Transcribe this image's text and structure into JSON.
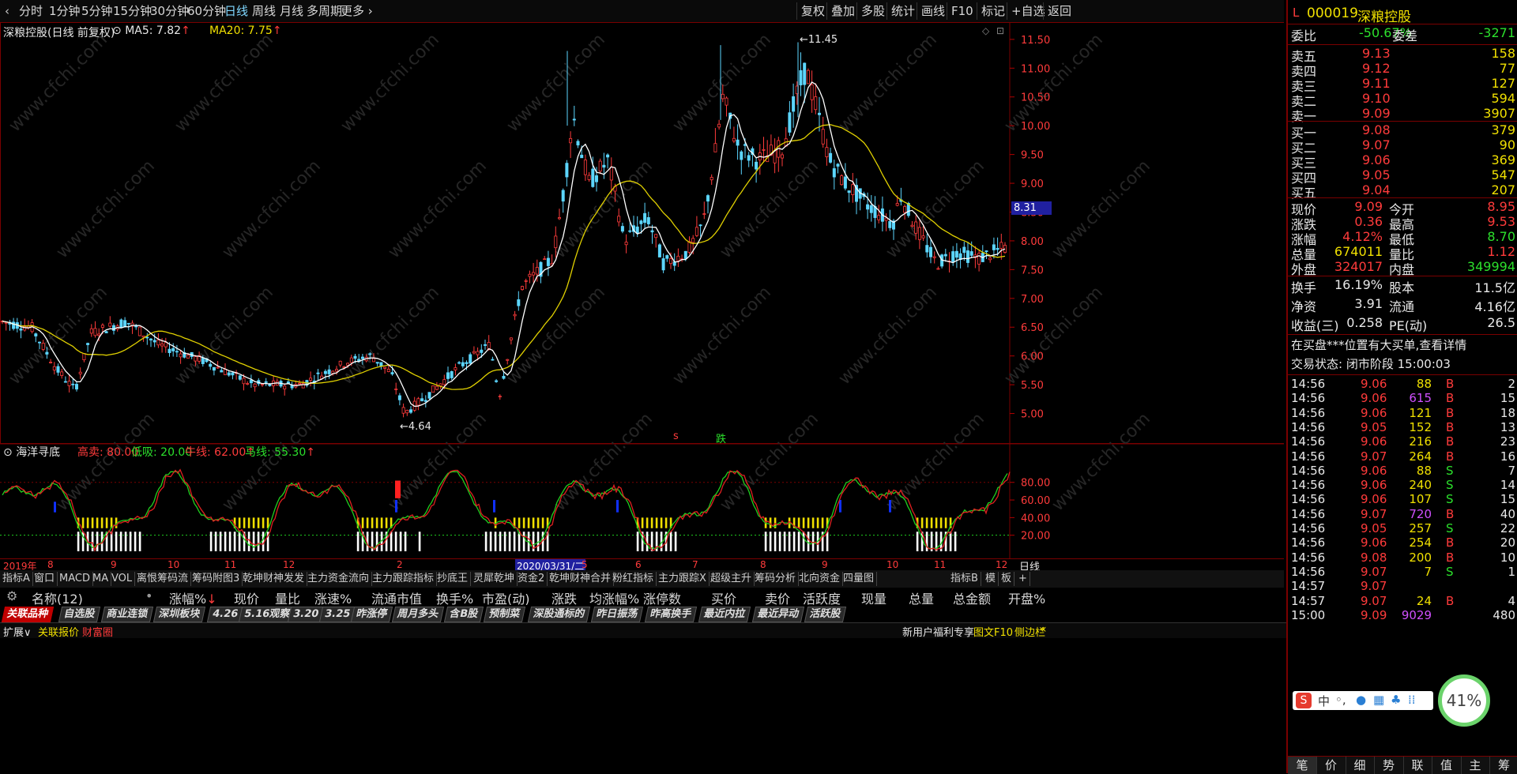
{
  "toolbar": {
    "periods": [
      "分时",
      "1分钟",
      "5分钟",
      "15分钟",
      "30分钟",
      "60分钟",
      "日线",
      "周线",
      "月线",
      "多周期",
      "更多"
    ],
    "active_period": "日线",
    "more_arrow": "›",
    "right_buttons": [
      "复权",
      "叠加",
      "多股",
      "统计",
      "画线",
      "F10",
      "标记",
      "+自选",
      "返回"
    ]
  },
  "chart": {
    "title": "深粮控股(日线 前复权)",
    "ma5_label": "MA5: 7.82",
    "ma20_label": "MA20: 7.75",
    "up_arrow": "↑",
    "watermark": "www.cfchi.com",
    "price_ticks": [
      "11.50",
      "11.00",
      "10.50",
      "10.00",
      "9.50",
      "9.00",
      "8.50",
      "8.00",
      "7.50",
      "7.00",
      "6.50",
      "6.00",
      "5.50",
      "5.00"
    ],
    "current_price_tag": "8.31",
    "high_marker": "11.45",
    "low_marker": "4.64",
    "signal_s": "s",
    "signal_die": "跌",
    "colors": {
      "up": "#ff3b3b",
      "down": "#5cd6ff",
      "ma5": "#ffffff",
      "ma20": "#e0d000"
    }
  },
  "indicator": {
    "name": "海洋寻底",
    "gaomai": "高卖: 80.00",
    "dixi": "低吸: 20.00",
    "niuxian": "牛线: 62.00",
    "maxian": "马线: 55.30",
    "ticks": [
      "80.00",
      "60.00",
      "40.00",
      "20.00"
    ]
  },
  "date_axis": {
    "labels": [
      "2019年",
      "8",
      "9",
      "10",
      "11",
      "12",
      "2",
      "2020/03/31/二",
      "5",
      "6",
      "7",
      "8",
      "9",
      "10",
      "11",
      "12"
    ],
    "right_label": "日线"
  },
  "indicator_tabs": [
    "指标A",
    "窗口",
    "MACD",
    "MA",
    "VOL",
    "离恨筹码流",
    "筹码附图3",
    "乾坤财神发发",
    "主力资金流向",
    "主力跟踪指标",
    "抄底王",
    "灵犀乾坤",
    "资金2",
    "乾坤财神合并",
    "粉红指标",
    "主力跟踪X",
    "超级主升",
    "筹码分析",
    "北向资金",
    "四量图"
  ],
  "indicator_tabs_right": [
    "指标B",
    "模",
    "板",
    "+"
  ],
  "list_header": {
    "name": "名称(12)",
    "cols": [
      "涨幅%",
      "现价",
      "量比",
      "涨速%",
      "流通市值",
      "换手%",
      "市盈(动)",
      "涨跌",
      "均涨幅%",
      "涨停数",
      "买价",
      "卖价",
      "活跃度",
      "现量",
      "总量",
      "总金额",
      "开盘%"
    ]
  },
  "filter_tabs": [
    "关联品种",
    "自选股",
    "商业连锁",
    "深圳板块",
    "4.26",
    "5.16观察",
    "3.20",
    "3.25",
    "昨涨停",
    "周月多头",
    "含B股",
    "预制菜",
    "深股通标的",
    "昨日振荡",
    "昨高换手",
    "最近内拉",
    "最近异动",
    "活跃股"
  ],
  "status_bar": {
    "expand": "扩展∨",
    "quote": "关联报价",
    "fortune": "财富圈",
    "promo": "新用户福利专享",
    "f10": "图文F10",
    "sidebar": "侧边栏",
    "arrows": "«"
  },
  "right_panel": {
    "code": "000019",
    "name": "深粮控股",
    "weibi_label": "委比",
    "weibi": "-50.67%",
    "weicha_label": "委差",
    "weicha": "-3271",
    "asks": [
      {
        "label": "卖五",
        "price": "9.13",
        "vol": "158"
      },
      {
        "label": "卖四",
        "price": "9.12",
        "vol": "77"
      },
      {
        "label": "卖三",
        "price": "9.11",
        "vol": "127"
      },
      {
        "label": "卖二",
        "price": "9.10",
        "vol": "594"
      },
      {
        "label": "卖一",
        "price": "9.09",
        "vol": "3907"
      }
    ],
    "bids": [
      {
        "label": "买一",
        "price": "9.08",
        "vol": "379"
      },
      {
        "label": "买二",
        "price": "9.07",
        "vol": "90"
      },
      {
        "label": "买三",
        "price": "9.06",
        "vol": "369"
      },
      {
        "label": "买四",
        "price": "9.05",
        "vol": "547"
      },
      {
        "label": "买五",
        "price": "9.04",
        "vol": "207"
      }
    ],
    "quotes": [
      {
        "l1": "现价",
        "v1": "9.09",
        "l2": "今开",
        "v2": "8.95",
        "c1": "red",
        "c2": "red"
      },
      {
        "l1": "涨跌",
        "v1": "0.36",
        "l2": "最高",
        "v2": "9.53",
        "c1": "red",
        "c2": "red"
      },
      {
        "l1": "涨幅",
        "v1": "4.12%",
        "l2": "最低",
        "v2": "8.70",
        "c1": "red",
        "c2": "green"
      },
      {
        "l1": "总量",
        "v1": "674011",
        "l2": "量比",
        "v2": "1.12",
        "c1": "yellow",
        "c2": "red"
      },
      {
        "l1": "外盘",
        "v1": "324017",
        "l2": "内盘",
        "v2": "349994",
        "c1": "red",
        "c2": "green"
      }
    ],
    "stats": [
      {
        "l1": "换手",
        "v1": "16.19%",
        "l2": "股本",
        "v2": "11.5亿"
      },
      {
        "l1": "净资",
        "v1": "3.91",
        "l2": "流通",
        "v2": "4.16亿"
      },
      {
        "l1": "收益(三)",
        "v1": "0.258",
        "l2": "PE(动)",
        "v2": "26.5"
      }
    ],
    "notice": "在买盘***位置有大买单,查看详情",
    "trade_state": "交易状态: 闭市阶段 15:00:03",
    "ticks": [
      {
        "t": "14:56",
        "p": "9.06",
        "v": "88",
        "d": "B",
        "n": "2"
      },
      {
        "t": "14:56",
        "p": "9.06",
        "v": "615",
        "d": "B",
        "n": "15"
      },
      {
        "t": "14:56",
        "p": "9.06",
        "v": "121",
        "d": "B",
        "n": "18"
      },
      {
        "t": "14:56",
        "p": "9.05",
        "v": "152",
        "d": "B",
        "n": "13"
      },
      {
        "t": "14:56",
        "p": "9.06",
        "v": "216",
        "d": "B",
        "n": "23"
      },
      {
        "t": "14:56",
        "p": "9.07",
        "v": "264",
        "d": "B",
        "n": "16"
      },
      {
        "t": "14:56",
        "p": "9.06",
        "v": "88",
        "d": "S",
        "n": "7"
      },
      {
        "t": "14:56",
        "p": "9.06",
        "v": "240",
        "d": "S",
        "n": "14"
      },
      {
        "t": "14:56",
        "p": "9.06",
        "v": "107",
        "d": "S",
        "n": "15"
      },
      {
        "t": "14:56",
        "p": "9.07",
        "v": "720",
        "d": "B",
        "n": "40"
      },
      {
        "t": "14:56",
        "p": "9.05",
        "v": "257",
        "d": "S",
        "n": "22"
      },
      {
        "t": "14:56",
        "p": "9.06",
        "v": "254",
        "d": "B",
        "n": "20"
      },
      {
        "t": "14:56",
        "p": "9.08",
        "v": "200",
        "d": "B",
        "n": "10"
      },
      {
        "t": "14:56",
        "p": "9.07",
        "v": "7",
        "d": "S",
        "n": "1"
      },
      {
        "t": "14:57",
        "p": "9.07",
        "v": "",
        "d": "",
        "n": ""
      },
      {
        "t": "14:57",
        "p": "9.07",
        "v": "24",
        "d": "B",
        "n": "4"
      },
      {
        "t": "15:00",
        "p": "9.09",
        "v": "9029",
        "d": "",
        "n": "480"
      }
    ],
    "badge_percent": "41%",
    "bottom_tabs": [
      "笔",
      "价",
      "细",
      "势",
      "联",
      "值",
      "主",
      "筹"
    ]
  }
}
